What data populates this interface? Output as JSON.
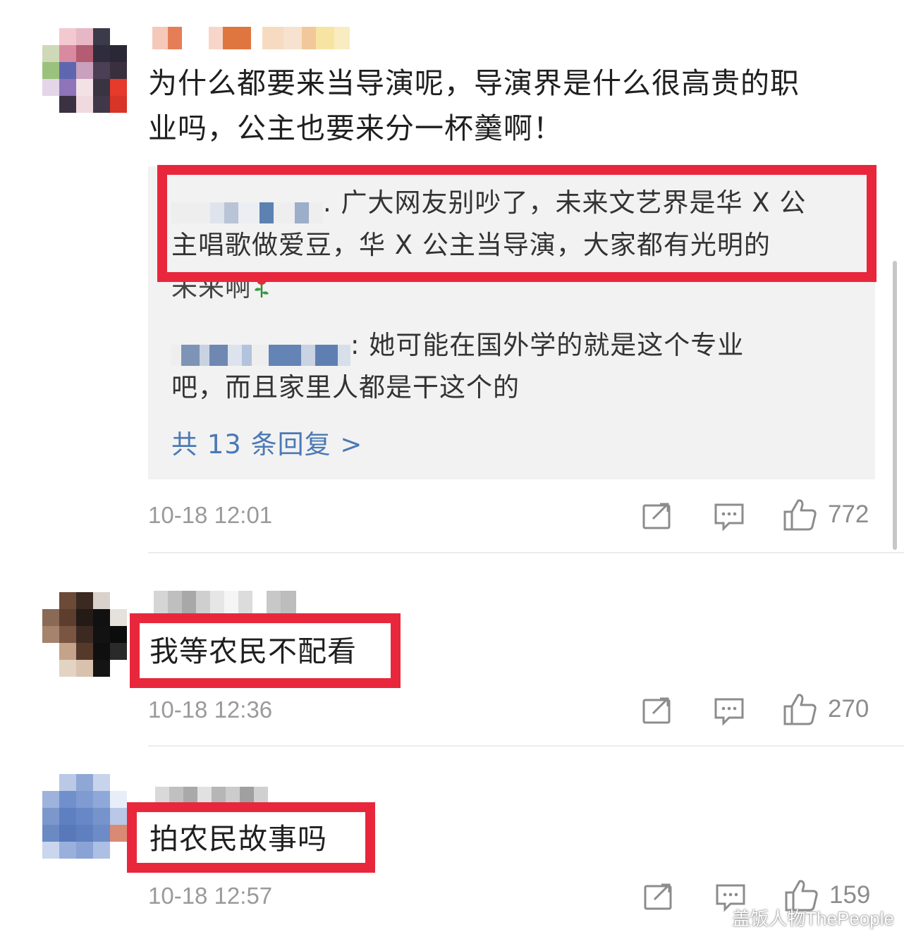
{
  "comments": [
    {
      "text": "为什么都要来当导演呢，导演界是什么很高贵的职业吗，公主也要来分一杯羹啊！",
      "text_line1": "为什么都要来当导演呢，导演界是什么很高贵的职",
      "text_line2": "业吗，公主也要来分一杯羹啊！",
      "replies": [
        {
          "line1": ". 广大网友别吵了，未来文艺界是华 X 公",
          "line2": "主唱歌做爱豆，华 X 公主当导演，大家都有光明的",
          "line3": "未来啊"
        },
        {
          "line1": ": 她可能在国外学的就是这个专业",
          "line2": "吧，而且家里人都是干这个的"
        }
      ],
      "more_replies": "共 13 条回复 >",
      "timestamp": "10-18 12:01",
      "likes": "772"
    },
    {
      "text": "我等农民不配看",
      "timestamp": "10-18 12:36",
      "likes": "270"
    },
    {
      "text": "拍农民故事吗",
      "timestamp": "10-18 12:57",
      "likes": "159"
    }
  ],
  "colors": {
    "highlight": "#e8273c",
    "link": "#4a79b5",
    "reply_bg": "#f2f2f2",
    "meta": "#9a9a9a"
  },
  "icons": [
    "share-icon",
    "comment-icon",
    "thumbs-up-icon",
    "rose-icon"
  ],
  "watermark": "盖饭人物ThePeople"
}
